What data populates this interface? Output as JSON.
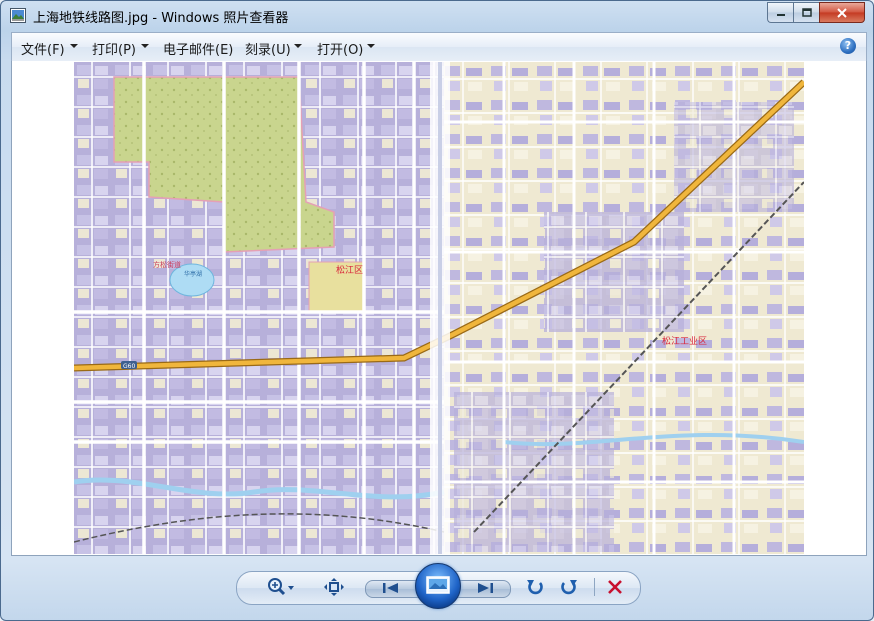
{
  "window": {
    "title": "上海地铁线路图.jpg - Windows 照片查看器"
  },
  "menu": {
    "items": [
      {
        "label": "文件(F)",
        "has_dropdown": true
      },
      {
        "label": "打印(P)",
        "has_dropdown": true
      },
      {
        "label": "电子邮件(E)",
        "has_dropdown": false
      },
      {
        "label": "刻录(U)",
        "has_dropdown": true
      },
      {
        "label": "打开(O)",
        "has_dropdown": true
      }
    ],
    "help_label": "?"
  },
  "image": {
    "description_label": "",
    "map_labels": {
      "district": "松江区",
      "town": "方松街道",
      "park": "华亭湖",
      "industrial": "松江工业区",
      "road_shield": "G60"
    }
  },
  "toolbar": {
    "icons": [
      "zoom-icon",
      "actual-size-icon",
      "previous-icon",
      "slideshow-icon",
      "next-icon",
      "rotate-left-icon",
      "rotate-right-icon",
      "delete-icon"
    ]
  },
  "colors": {
    "accent": "#1f64c8",
    "delete": "#c8102e",
    "map_urban": "#b9b3dc",
    "map_road": "#ffffff",
    "map_highway": "#f0b63c"
  }
}
